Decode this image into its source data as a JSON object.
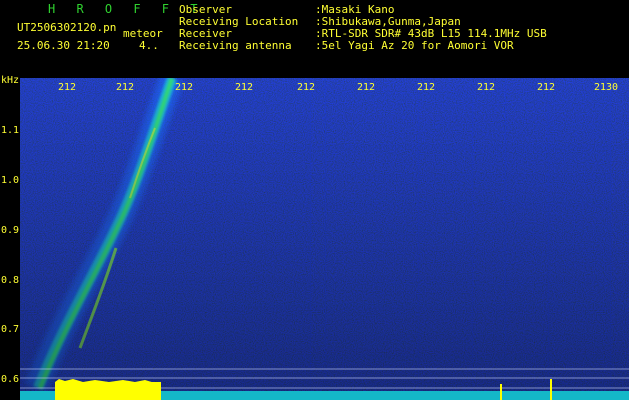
{
  "header": {
    "brand": "H R O F F T",
    "filename": "UT2506302120.pn",
    "filename_suffix": "meteor",
    "datetime": "25.06.30 21:20",
    "counter": "4.."
  },
  "meta": [
    {
      "key": "Observer",
      "value": ":Masaki Kano"
    },
    {
      "key": "Receiving Location",
      "value": ":Shibukawa,Gunma,Japan"
    },
    {
      "key": "Receiver",
      "value": ":RTL-SDR SDR# 43dB L15 114.1MHz USB"
    },
    {
      "key": "Receiving antenna",
      "value": ":5el Yagi Az 20 for Aomori VOR"
    }
  ],
  "axis": {
    "unit": "kHz",
    "y_ticks": [
      "1.1",
      "1.0",
      "0.9",
      "0.8",
      "0.7",
      "0.6"
    ],
    "x_ticks": [
      "212",
      "212",
      "212",
      "212",
      "212",
      "212",
      "212",
      "212",
      "212",
      "2130"
    ]
  },
  "colors": {
    "text": "#ffff33",
    "brand": "#2fd12f",
    "background": "#000000",
    "noise": "#0a1a8c",
    "echo": "#36e06a",
    "strip": "#ffff00"
  }
}
